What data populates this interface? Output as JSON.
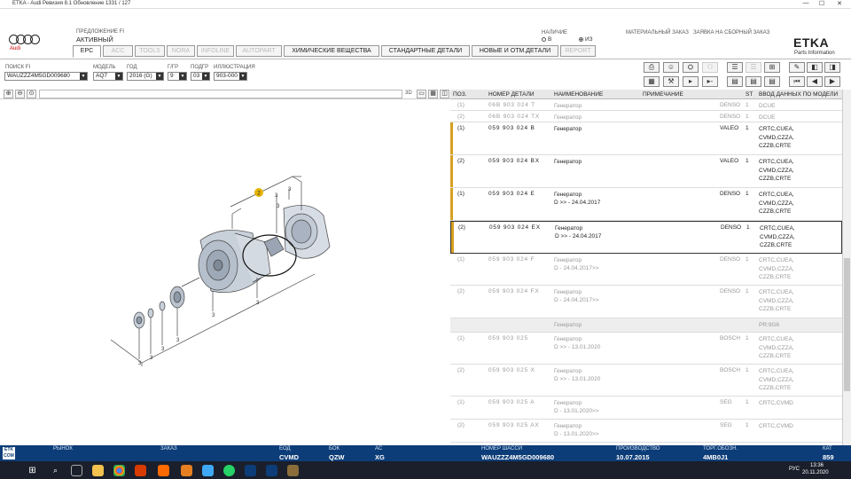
{
  "window": {
    "title": "ETKA - Audi Ревизия 8.1 Обновление 1331 / 127",
    "controls": [
      "—",
      "☐",
      "✕"
    ]
  },
  "header": {
    "brand": "Audi",
    "predlozhenie_label": "ПРЕДЛОЖЕНИЕ FI",
    "status": "АКТИВНЫЙ",
    "nalichie_label": "НАЛИЧИЕ",
    "radio_v": "В",
    "radio_iz": "ИЗ",
    "material_order": "МАТЕРИАЛЬНЫЙ ЗАКАЗ",
    "collective_order": "ЗАЯВКА НА СБОРНЫЙ ЗАКАЗ",
    "etka_logo": "ETKA",
    "etka_sub": "Parts Information"
  },
  "tabs": [
    {
      "label": "EPC",
      "state": "selected"
    },
    {
      "label": "ACC",
      "state": "disabled"
    },
    {
      "label": "TOOLS",
      "state": "disabled"
    },
    {
      "label": "NORA",
      "state": "disabled"
    },
    {
      "label": "INFOLINE",
      "state": "disabled"
    },
    {
      "label": "AUTOPART",
      "state": "disabled"
    },
    {
      "label": "ХИМИЧЕСКИЕ ВЕЩЕСТВА",
      "state": "normal"
    },
    {
      "label": "СТАНДАРТНЫЕ ДЕТАЛИ",
      "state": "normal"
    },
    {
      "label": "НОВЫЕ И ОТМ.ДЕТАЛИ",
      "state": "normal"
    },
    {
      "label": "REPORT",
      "state": "disabled"
    }
  ],
  "filters": {
    "search_label": "ПОИСК FI",
    "search_value": "WAUZZZ4M5GD009680",
    "model_label": "МОДЕЛЬ",
    "model_value": "AQ7",
    "year_label": "ГОД",
    "year_value": "2016 (G)",
    "hg_label": "Г/ГР",
    "hg_value": "9",
    "ug_label": "ПОДГР",
    "ug_value": "03",
    "illus_label": "ИЛЛЮСТРАЦИЯ",
    "illus_value": "903-000"
  },
  "image_toolbar": {
    "zoom_value": "3D"
  },
  "illustration": {
    "callout_number": "2",
    "part_numbers": [
      "3",
      "3",
      "3",
      "3",
      "3",
      "3",
      "3",
      "3",
      "3"
    ]
  },
  "grid": {
    "headers": [
      "ПОЗ.",
      "НОМЕР ДЕТАЛИ",
      "НАИМЕНОВАНИЕ",
      "ПРИМЕЧАНИЕ",
      "ST",
      "ВВОД ДАННЫХ ПО МОДЕЛИ"
    ],
    "rows": [
      {
        "pos": "(1)",
        "part": "06B 903 024 T",
        "name": "Генератор",
        "name2": "",
        "note": "DENSO",
        "st": "1",
        "inp": [
          "DCUE"
        ],
        "style": "grey",
        "h": 13
      },
      {
        "pos": "(2)",
        "part": "06B 903 024 TX",
        "name": "Генератор",
        "name2": "",
        "note": "DENSO",
        "st": "1",
        "inp": [
          "DCUE"
        ],
        "style": "grey",
        "h": 13
      },
      {
        "pos": "(1)",
        "part": "059 903 024 B",
        "name": "Генератор",
        "name2": "",
        "note": "VALEO",
        "st": "1",
        "inp": [
          "CRTC,CUEA,",
          "CVMD,CZZA,",
          "CZZB,CRTE"
        ],
        "style": "dark",
        "mark": true,
        "h": 37
      },
      {
        "pos": "(2)",
        "part": "059 903 024 BX",
        "name": "Генератор",
        "name2": "",
        "note": "VALEO",
        "st": "1",
        "inp": [
          "CRTC,CUEA,",
          "CVMD,CZZA,",
          "CZZB,CRTE"
        ],
        "style": "dark",
        "mark": true,
        "h": 37
      },
      {
        "pos": "(1)",
        "part": "059 903 024 E",
        "name": "Генератор",
        "name2": "D            >> - 24.04.2017",
        "note": "DENSO",
        "st": "1",
        "inp": [
          "CRTC,CUEA,",
          "CVMD,CZZA,",
          "CZZB,CRTE"
        ],
        "style": "dark",
        "mark": true,
        "h": 37
      },
      {
        "pos": "(2)",
        "part": "059 903 024 EX",
        "name": "Генератор",
        "name2": "D            >> - 24.04.2017",
        "note": "DENSO",
        "st": "1",
        "inp": [
          "CRTC,CUEA,",
          "CVMD,CZZA,",
          "CZZB,CRTE"
        ],
        "style": "dark sel",
        "mark": true,
        "h": 37
      },
      {
        "pos": "(1)",
        "part": "059 903 024 F",
        "name": "Генератор",
        "name2": "D - 24.04.2017>>",
        "note": "DENSO",
        "st": "1",
        "inp": [
          "CRTC,CUEA,",
          "CVMD,CZZA,",
          "CZZB,CRTE"
        ],
        "style": "grey",
        "h": 36
      },
      {
        "pos": "(2)",
        "part": "059 903 024 FX",
        "name": "Генератор",
        "name2": "D - 24.04.2017>>",
        "note": "DENSO",
        "st": "1",
        "inp": [
          "CRTC,CUEA,",
          "CVMD,CZZA,",
          "CZZB,CRTE"
        ],
        "style": "grey",
        "h": 37
      },
      {
        "pos": "",
        "part": "",
        "name": "Генератор",
        "name2": "",
        "note": "",
        "st": "",
        "inp": [
          "PR:9G6"
        ],
        "style": "grey band",
        "h": 16
      },
      {
        "pos": "(1)",
        "part": "059 903 025",
        "name": "Генератор",
        "name2": "D            >> - 13.01.2020",
        "note": "BOSCH",
        "st": "1",
        "inp": [
          "CRTC,CUEA,",
          "CVMD,CZZA,",
          "CZZB,CRTE"
        ],
        "style": "grey",
        "h": 36
      },
      {
        "pos": "(2)",
        "part": "059 903 025 X",
        "name": "Генератор",
        "name2": "D            >> - 13.01.2020",
        "note": "BOSCH",
        "st": "1",
        "inp": [
          "CRTC,CUEA,",
          "CVMD,CZZA,",
          "CZZB,CRTE"
        ],
        "style": "grey",
        "h": 36
      },
      {
        "pos": "(1)",
        "part": "059 903 025 A",
        "name": "Генератор",
        "name2": "D - 13.01.2020>>",
        "note": "SEG",
        "st": "1",
        "inp": [
          "CRTC,CVMD"
        ],
        "style": "grey",
        "h": 26
      },
      {
        "pos": "(2)",
        "part": "059 903 025 AX",
        "name": "Генератор",
        "name2": "D - 13.01.2020>>",
        "note": "SEG",
        "st": "1",
        "inp": [
          "CRTC,CVMD"
        ],
        "style": "grey",
        "h": 26
      }
    ]
  },
  "statusbar": {
    "market_label": "РЫНОК",
    "order_label": "ЗАКАЗ",
    "engine_label": "ЕОД",
    "engine_value": "CVMD",
    "gearbox_label": "БОК",
    "gearbox_value": "QZW",
    "ac_label": "АС",
    "ac_value": "XG",
    "vin_label": "НОМЕР ШАССИ",
    "vin_value": "WAUZZZ4M5GD009680",
    "prod_label": "ПРОИЗВОДСТВО",
    "prod_value": "10.07.2015",
    "trade_label": "ТОРГ.ОБОЗН.",
    "trade_value": "4MB0J1",
    "cat_label": "КАТ",
    "cat_value": "859"
  },
  "taskbar": {
    "lang": "РУС",
    "time": "13:36",
    "date": "20.11.2020"
  }
}
